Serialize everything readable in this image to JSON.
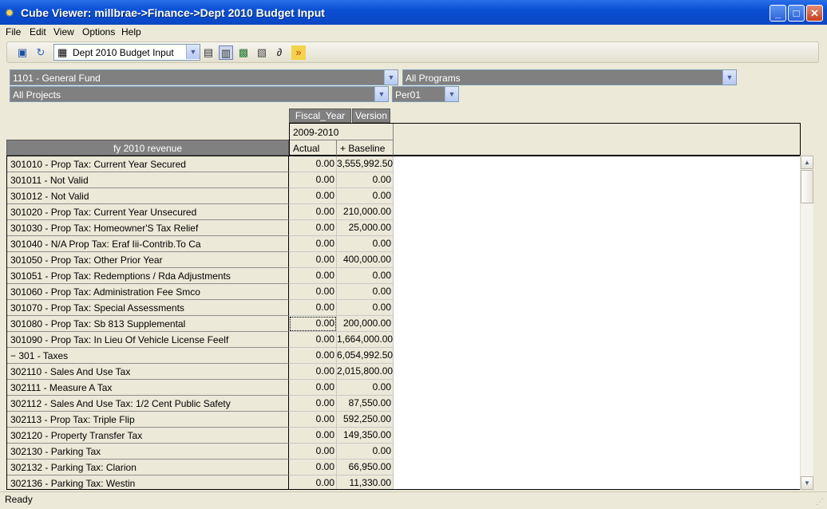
{
  "window": {
    "title": "Cube Viewer:  millbrae->Finance->Dept 2010 Budget Input"
  },
  "menu": [
    "File",
    "Edit",
    "View",
    "Options",
    "Help"
  ],
  "toolbar": {
    "view_name": "Dept 2010 Budget Input"
  },
  "dimensions": {
    "fund": "1101 - General Fund",
    "programs": "All Programs",
    "projects": "All Projects",
    "period": "Per01"
  },
  "column_dims": [
    "Fiscal_Year",
    "Version"
  ],
  "column_header": {
    "year": "2009-2010",
    "col1": "Actual",
    "col2": "+  Baseline"
  },
  "row_dim_title": "fy 2010 revenue",
  "rows": [
    {
      "label": "301010 - Prop Tax: Current Year Secured",
      "actual": "0.00",
      "baseline": "3,555,992.50"
    },
    {
      "label": "301011 - Not Valid",
      "actual": "0.00",
      "baseline": "0.00"
    },
    {
      "label": "301012 - Not Valid",
      "actual": "0.00",
      "baseline": "0.00"
    },
    {
      "label": "301020 - Prop Tax: Current Year Unsecured",
      "actual": "0.00",
      "baseline": "210,000.00"
    },
    {
      "label": "301030 - Prop Tax: Homeowner'S Tax Relief",
      "actual": "0.00",
      "baseline": "25,000.00"
    },
    {
      "label": "301040 - N/A  Prop Tax: Eraf Iii-Contrib.To Ca",
      "actual": "0.00",
      "baseline": "0.00"
    },
    {
      "label": "301050 - Prop Tax: Other Prior Year",
      "actual": "0.00",
      "baseline": "400,000.00"
    },
    {
      "label": "301051 - Prop Tax: Redemptions / Rda Adjustments",
      "actual": "0.00",
      "baseline": "0.00"
    },
    {
      "label": "301060 - Prop Tax: Administration Fee Smco",
      "actual": "0.00",
      "baseline": "0.00"
    },
    {
      "label": "301070 - Prop Tax: Special Assessments",
      "actual": "0.00",
      "baseline": "0.00"
    },
    {
      "label": "301080 - Prop Tax: Sb 813 Supplemental",
      "actual": "0.00",
      "baseline": "200,000.00"
    },
    {
      "label": "301090 - Prop Tax: In Lieu Of Vehicle License Feelf",
      "actual": "0.00",
      "baseline": "1,664,000.00"
    },
    {
      "label": "−  301 - Taxes",
      "actual": "0.00",
      "baseline": "6,054,992.50"
    },
    {
      "label": "302110 - Sales And Use Tax",
      "actual": "0.00",
      "baseline": "2,015,800.00"
    },
    {
      "label": "302111 - Measure A Tax",
      "actual": "0.00",
      "baseline": "0.00"
    },
    {
      "label": "302112 - Sales And Use Tax: 1/2 Cent Public Safety",
      "actual": "0.00",
      "baseline": "87,550.00"
    },
    {
      "label": "302113 - Prop Tax: Triple Flip",
      "actual": "0.00",
      "baseline": "592,250.00"
    },
    {
      "label": "302120 - Property Transfer Tax",
      "actual": "0.00",
      "baseline": "149,350.00"
    },
    {
      "label": "302130 - Parking Tax",
      "actual": "0.00",
      "baseline": "0.00"
    },
    {
      "label": "302132 - Parking Tax: Clarion",
      "actual": "0.00",
      "baseline": "66,950.00"
    },
    {
      "label": "302136 - Parking Tax: Westin",
      "actual": "0.00",
      "baseline": "11,330.00"
    }
  ],
  "status": "Ready"
}
